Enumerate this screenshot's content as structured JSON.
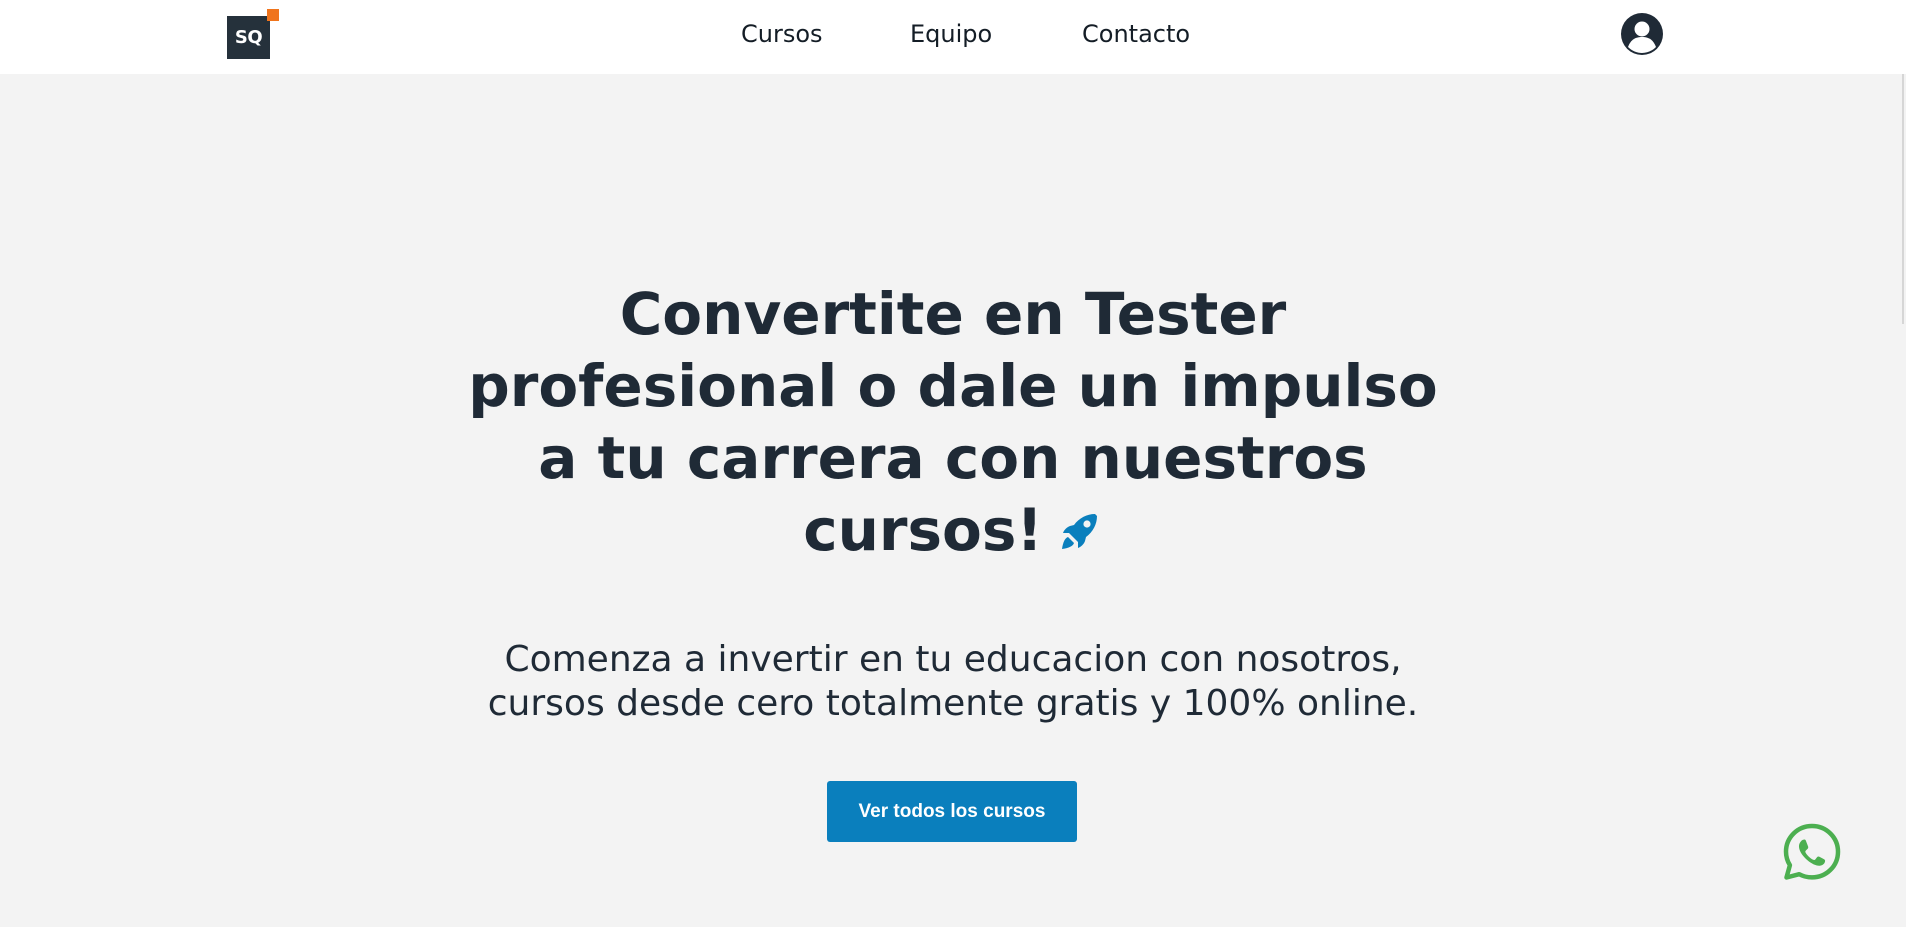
{
  "header": {
    "logo_text": "SQ",
    "nav": [
      {
        "label": "Cursos"
      },
      {
        "label": "Equipo"
      },
      {
        "label": "Contacto"
      }
    ],
    "user_icon": "user-circle-icon"
  },
  "hero": {
    "title": "Convertite en Tester profesional o dale un impulso a tu carrera con nuestros cursos!",
    "title_icon": "rocket-icon",
    "subtitle_line1": "Comenza a invertir en tu educacion con nosotros,",
    "subtitle_line2": "cursos desde cero totalmente gratis y 100% online.",
    "cta_label": "Ver todos los cursos"
  },
  "floating": {
    "whatsapp_icon": "whatsapp-icon"
  },
  "colors": {
    "background": "#f3f3f3",
    "header_bg": "#ffffff",
    "text_dark": "#1f2a36",
    "brand_dark": "#25313b",
    "brand_accent": "#f0741c",
    "cta_blue": "#0a7fbd",
    "whatsapp_green": "#4caf50"
  }
}
